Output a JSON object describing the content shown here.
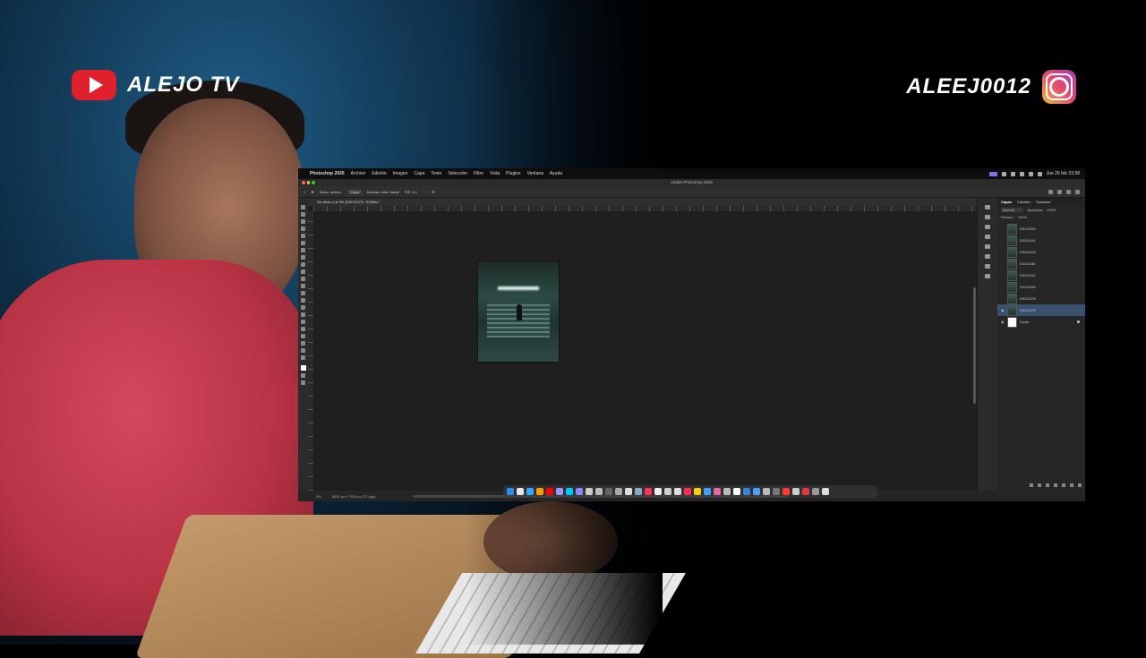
{
  "overlay": {
    "left_brand": "ALEJO TV",
    "right_brand": "ALEEJ0012"
  },
  "mac": {
    "menubar": {
      "app_name": "Photoshop 2026",
      "menus": [
        "Archivo",
        "Edición",
        "Imagen",
        "Capa",
        "Texto",
        "Selección",
        "Filtro",
        "Vista",
        "Plugins",
        "Ventana",
        "Ayuda"
      ],
      "datetime": "Jue 26 feb 23:38"
    },
    "window_title": "Adobe Photoshop 2026",
    "options_bar": {
      "auto_select_label": "Selec. autom.:",
      "auto_select_value": "Capa",
      "transform_label": "Mostrar contr. transf."
    },
    "document_tab": "Sin título-1 al 3% (DSC01079, RGB/8) *",
    "status": {
      "zoom": "3%",
      "doc_info": "6000 px x 7500 px (72 ppp)"
    },
    "panel": {
      "tabs": [
        "Capas",
        "Canales",
        "Trazados"
      ],
      "blend_mode": "Normal",
      "opacity_label": "Opacidad:",
      "opacity_value": "100%",
      "fill_label": "Relleno:",
      "fill_value": "100%",
      "layers": [
        "DSC01900",
        "DSC01441",
        "DSC01403",
        "DSC01186",
        "DSC01151",
        "DSC01900",
        "DSC01078",
        "DSC01079",
        "Fondo"
      ]
    },
    "dock_colors": [
      "#2b8cf0",
      "#e6e6e6",
      "#31a8ff",
      "#ff9a00",
      "#ff0000",
      "#9999ff",
      "#00c8ff",
      "#8a8aff",
      "#cccccc",
      "#bbbbbb",
      "#666666",
      "#aaaaaa",
      "#dddddd",
      "#88aacc",
      "#ff3355",
      "#eeeeee",
      "#cccccc",
      "#dddddd",
      "#ff2d55",
      "#ffcc00",
      "#3ca1ff",
      "#ee66aa",
      "#bbbbbb",
      "#ffffff",
      "#3a80e0",
      "#4aa0ff",
      "#bbbbbb",
      "#777777",
      "#ff3b30",
      "#cccccc",
      "#e03a3a",
      "#9a9a9a",
      "#dddddd"
    ]
  }
}
